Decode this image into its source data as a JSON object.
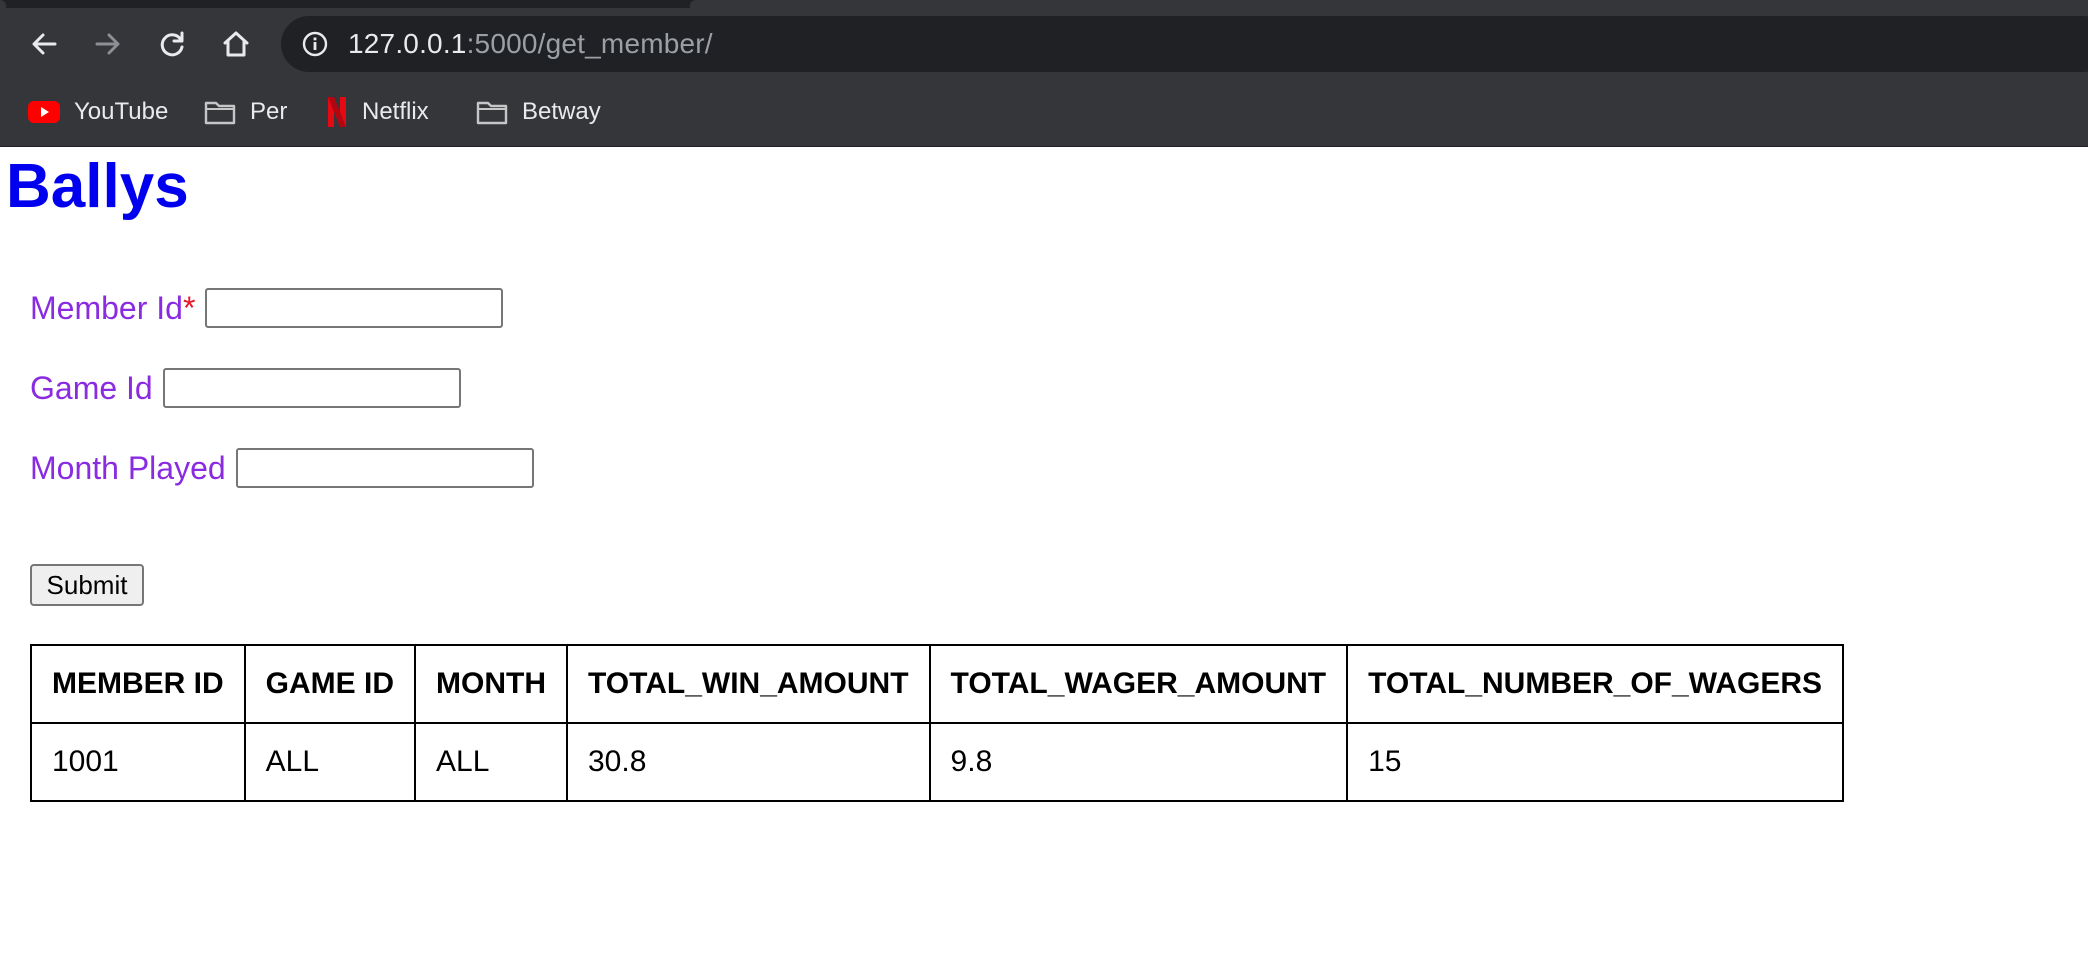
{
  "browser": {
    "url_host": "127.0.0.1",
    "url_path": ":5000/get_member/",
    "icons": [
      "back-arrow-icon",
      "forward-arrow-icon",
      "reload-icon",
      "home-icon",
      "info-icon"
    ],
    "bookmarks": [
      {
        "label": "YouTube",
        "icon": "youtube-icon"
      },
      {
        "label": "Per",
        "icon": "folder-icon"
      },
      {
        "label": "Netflix",
        "icon": "netflix-icon"
      },
      {
        "label": "Betway",
        "icon": "folder-icon"
      }
    ]
  },
  "page": {
    "title": "Ballys",
    "title_color": "#0000ee",
    "label_color": "#8a2be2",
    "required_color": "#e8162a",
    "form": {
      "member_id_label": "Member Id",
      "required_marker": "*",
      "member_id_value": "",
      "game_id_label": "Game Id",
      "game_id_value": "",
      "month_played_label": "Month Played",
      "month_played_value": "",
      "submit_label": "Submit"
    },
    "table": {
      "headers": [
        "MEMBER ID",
        "GAME ID",
        "MONTH",
        "TOTAL_WIN_AMOUNT",
        "TOTAL_WAGER_AMOUNT",
        "TOTAL_NUMBER_OF_WAGERS"
      ],
      "rows": [
        [
          "1001",
          "ALL",
          "ALL",
          "30.8",
          "9.8",
          "15"
        ]
      ]
    }
  }
}
